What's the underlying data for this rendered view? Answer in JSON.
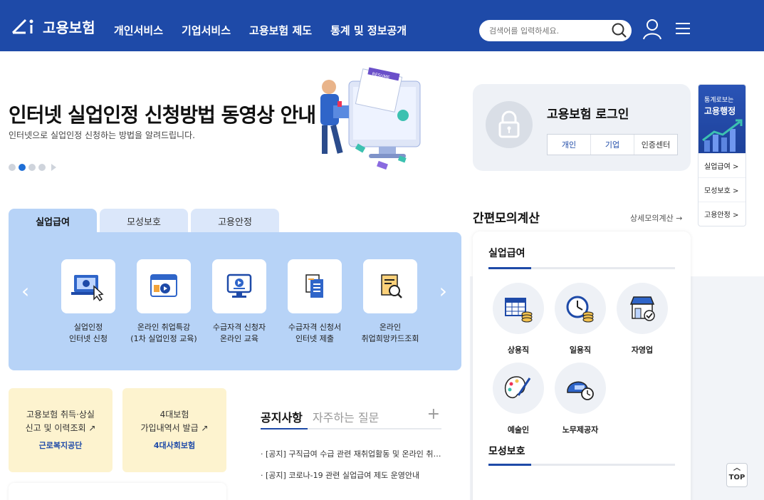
{
  "header": {
    "logo": "고용보험",
    "nav": [
      "개인서비스",
      "기업서비스",
      "고용보험 제도",
      "통계 및 정보공개"
    ],
    "search_placeholder": "검색어를 입력하세요."
  },
  "hero": {
    "title": "인터넷 실업인정 신청방법 동영상 안내",
    "subtitle": "인터넷으로 실업인정 신청하는 방법을 알려드립니다.",
    "illustration_label": "RESUME"
  },
  "login": {
    "title": "고용보험 로그인",
    "tabs": [
      "개인",
      "기업",
      "인증센터"
    ]
  },
  "side_banner": {
    "line1": "통계로보는",
    "line2": "고용행정",
    "links": [
      "실업급여 >",
      "모성보호 >",
      "고용안정 >"
    ]
  },
  "service_tabs": [
    "실업급여",
    "모성보호",
    "고용안정"
  ],
  "services": [
    {
      "line1": "실업인정",
      "line2": "인터넷 신청"
    },
    {
      "line1": "온라인 취업특강",
      "line2": "(1차 실업인정 교육)"
    },
    {
      "line1": "수급자격 신청자",
      "line2": "온라인 교육"
    },
    {
      "line1": "수급자격 신청서",
      "line2": "인터넷 제출"
    },
    {
      "line1": "온라인",
      "line2": "취업희망카드조회"
    }
  ],
  "banners": [
    {
      "line1": "고용보험 취득·상실",
      "line2": "신고 및 이력조회 ↗",
      "org": "근로복지공단"
    },
    {
      "line1": "4대보험",
      "line2": "가입내역서 발급 ↗",
      "org": "4대사회보험"
    }
  ],
  "notice": {
    "tab_active": "공지사항",
    "tab_inactive": "자주하는 질문",
    "plus": "+",
    "items": [
      "[공지] 구직급여 수급 관련 재취업활동 및 온라인 취업특강 안내",
      "[공지] 코로나-19 관련 실업급여 제도 운영안내"
    ]
  },
  "calc": {
    "title": "간편모의계산",
    "more": "상세모의계산 →",
    "section1": "실업급여",
    "items": [
      "상용직",
      "일용직",
      "자영업",
      "예술인",
      "노무제공자"
    ],
    "section2": "모성보호"
  },
  "top_button": "TOP",
  "colors": {
    "primary": "#1e4aa8",
    "panel": "#b7d3f7",
    "banner": "#fdf3cf"
  }
}
